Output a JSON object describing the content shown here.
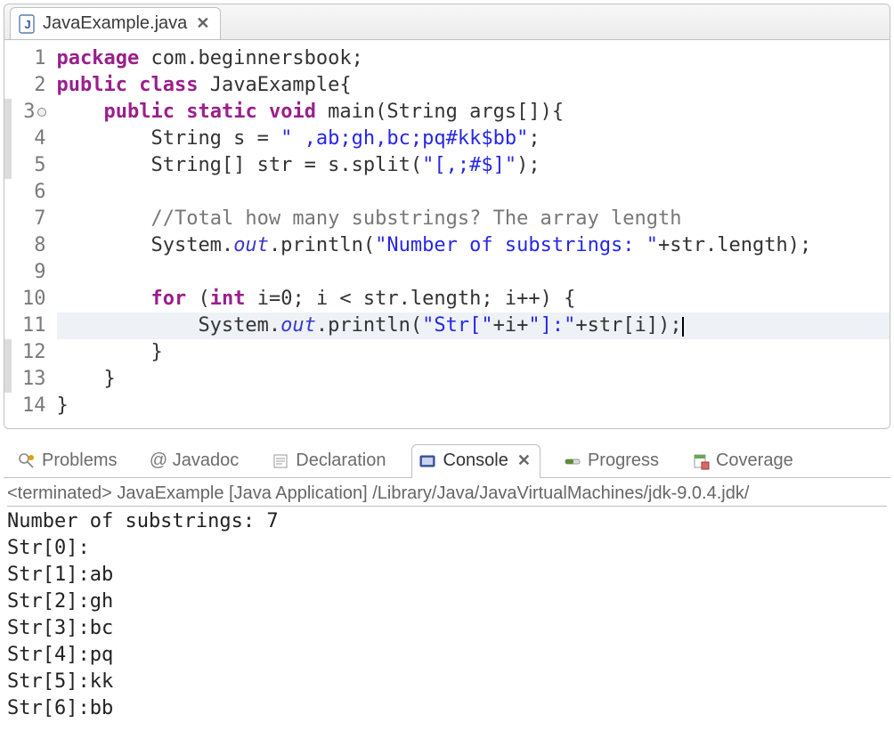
{
  "editor": {
    "tab": {
      "filename": "JavaExample.java",
      "close_glyph": "✕"
    },
    "code_lines": [
      {
        "n": 1,
        "folded": false,
        "hl": false,
        "cursor": false,
        "tokens": [
          {
            "t": "kw",
            "v": "package"
          },
          {
            "t": "plain",
            "v": " com.beginnersbook;"
          }
        ]
      },
      {
        "n": 2,
        "folded": false,
        "hl": false,
        "cursor": false,
        "tokens": [
          {
            "t": "kw",
            "v": "public"
          },
          {
            "t": "plain",
            "v": " "
          },
          {
            "t": "kw",
            "v": "class"
          },
          {
            "t": "plain",
            "v": " JavaExample{"
          }
        ]
      },
      {
        "n": 3,
        "folded": true,
        "hl": true,
        "cursor": false,
        "tokens": [
          {
            "t": "plain",
            "v": "    "
          },
          {
            "t": "kw",
            "v": "public"
          },
          {
            "t": "plain",
            "v": " "
          },
          {
            "t": "kw",
            "v": "static"
          },
          {
            "t": "plain",
            "v": " "
          },
          {
            "t": "kw",
            "v": "void"
          },
          {
            "t": "plain",
            "v": " main(String args[]){"
          }
        ]
      },
      {
        "n": 4,
        "folded": false,
        "hl": true,
        "cursor": false,
        "tokens": [
          {
            "t": "plain",
            "v": "        String s = "
          },
          {
            "t": "str",
            "v": "\" ,ab;gh,bc;pq#kk$bb\""
          },
          {
            "t": "plain",
            "v": ";"
          }
        ]
      },
      {
        "n": 5,
        "folded": false,
        "hl": true,
        "cursor": false,
        "tokens": [
          {
            "t": "plain",
            "v": "        String[] str = s.split("
          },
          {
            "t": "str",
            "v": "\"[,;#$]\""
          },
          {
            "t": "plain",
            "v": ");"
          }
        ]
      },
      {
        "n": 6,
        "folded": false,
        "hl": false,
        "cursor": false,
        "tokens": []
      },
      {
        "n": 7,
        "folded": false,
        "hl": false,
        "cursor": false,
        "tokens": [
          {
            "t": "plain",
            "v": "        "
          },
          {
            "t": "cmt",
            "v": "//Total how many substrings? The array length"
          }
        ]
      },
      {
        "n": 8,
        "folded": false,
        "hl": false,
        "cursor": false,
        "tokens": [
          {
            "t": "plain",
            "v": "        System."
          },
          {
            "t": "field",
            "v": "out"
          },
          {
            "t": "plain",
            "v": ".println("
          },
          {
            "t": "str",
            "v": "\"Number of substrings: \""
          },
          {
            "t": "plain",
            "v": "+str.length);"
          }
        ]
      },
      {
        "n": 9,
        "folded": false,
        "hl": false,
        "cursor": false,
        "tokens": []
      },
      {
        "n": 10,
        "folded": false,
        "hl": false,
        "cursor": false,
        "tokens": [
          {
            "t": "plain",
            "v": "        "
          },
          {
            "t": "kw",
            "v": "for"
          },
          {
            "t": "plain",
            "v": " ("
          },
          {
            "t": "kw",
            "v": "int"
          },
          {
            "t": "plain",
            "v": " i=0; i < str.length; i++) {"
          }
        ]
      },
      {
        "n": 11,
        "folded": false,
        "hl": false,
        "cursor": true,
        "tokens": [
          {
            "t": "plain",
            "v": "            System."
          },
          {
            "t": "field",
            "v": "out"
          },
          {
            "t": "plain",
            "v": ".println("
          },
          {
            "t": "str",
            "v": "\"Str[\""
          },
          {
            "t": "plain",
            "v": "+i+"
          },
          {
            "t": "str",
            "v": "\"]:\""
          },
          {
            "t": "plain",
            "v": "+str[i]);"
          }
        ]
      },
      {
        "n": 12,
        "folded": false,
        "hl": true,
        "cursor": false,
        "tokens": [
          {
            "t": "plain",
            "v": "        }"
          }
        ]
      },
      {
        "n": 13,
        "folded": false,
        "hl": true,
        "cursor": false,
        "tokens": [
          {
            "t": "plain",
            "v": "    }"
          }
        ]
      },
      {
        "n": 14,
        "folded": false,
        "hl": false,
        "cursor": false,
        "tokens": [
          {
            "t": "plain",
            "v": "}"
          }
        ]
      }
    ]
  },
  "views": {
    "tabs": [
      {
        "id": "problems",
        "label": "Problems",
        "active": false
      },
      {
        "id": "javadoc",
        "label": "Javadoc",
        "active": false,
        "prefix": "@"
      },
      {
        "id": "declaration",
        "label": "Declaration",
        "active": false
      },
      {
        "id": "console",
        "label": "Console",
        "active": true
      },
      {
        "id": "progress",
        "label": "Progress",
        "active": false
      },
      {
        "id": "coverage",
        "label": "Coverage",
        "active": false
      }
    ],
    "close_glyph": "✕"
  },
  "console": {
    "run_header": "<terminated> JavaExample [Java Application] /Library/Java/JavaVirtualMachines/jdk-9.0.4.jdk/",
    "output_lines": [
      "Number of substrings: 7",
      "Str[0]:",
      "Str[1]:ab",
      "Str[2]:gh",
      "Str[3]:bc",
      "Str[4]:pq",
      "Str[5]:kk",
      "Str[6]:bb"
    ]
  }
}
